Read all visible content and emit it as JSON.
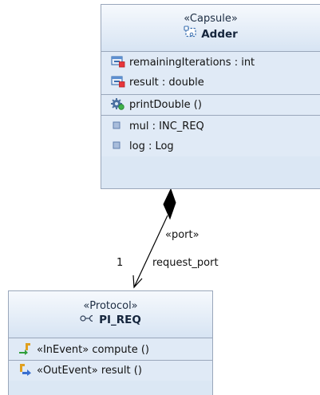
{
  "capsule": {
    "stereotype": "«Capsule»",
    "name": "Adder",
    "attributes": [
      {
        "text": "remainingIterations : int",
        "icon": "private-attribute-icon"
      },
      {
        "text": "result : double",
        "icon": "private-attribute-icon"
      }
    ],
    "operations": [
      {
        "text": "printDouble ()",
        "icon": "operation-gear-icon"
      }
    ],
    "ports": [
      {
        "text": "mul : INC_REQ",
        "icon": "port-icon"
      },
      {
        "text": "log : Log",
        "icon": "port-icon"
      }
    ]
  },
  "association": {
    "stereotype": "«port»",
    "role": "request_port",
    "multiplicity": "1"
  },
  "protocol": {
    "stereotype": "«Protocol»",
    "name": "PI_REQ",
    "events": [
      {
        "text": "«InEvent» compute ()",
        "icon": "in-event-icon"
      },
      {
        "text": "«OutEvent» result ()",
        "icon": "out-event-icon"
      }
    ]
  },
  "colors": {
    "box_fill": "#dbe7f4",
    "box_border": "#9aa7bb",
    "connector": "#000000"
  }
}
